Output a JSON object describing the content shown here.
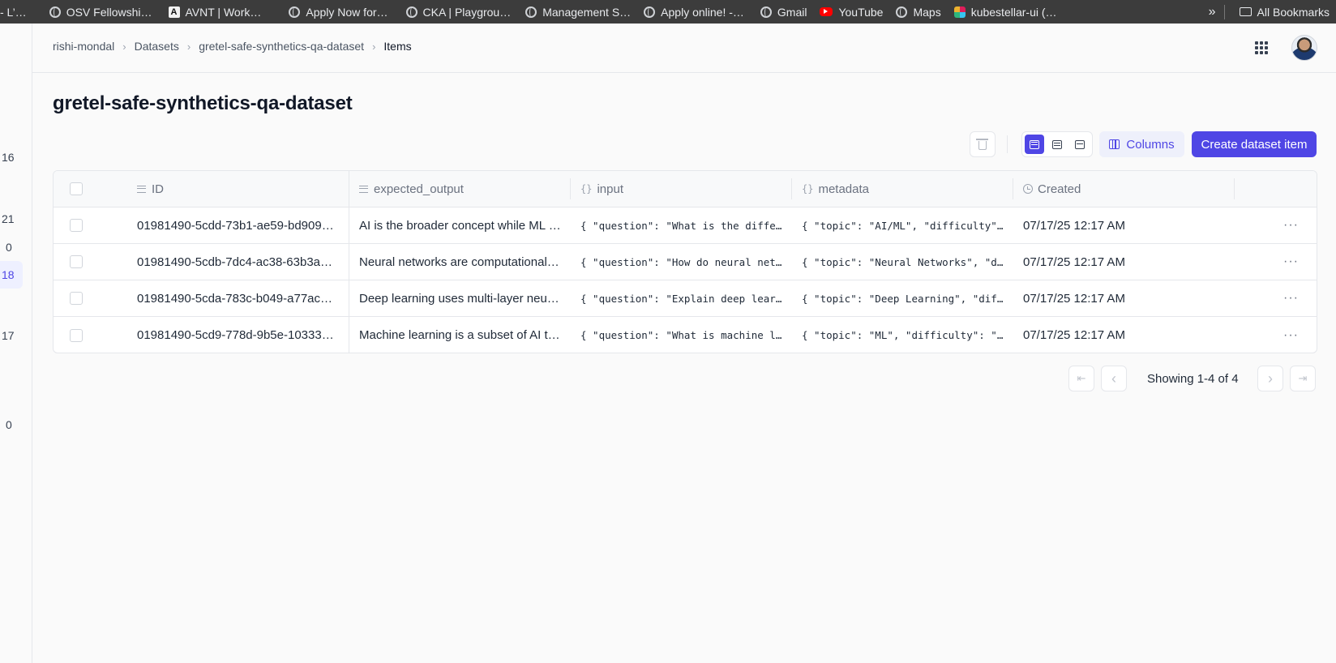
{
  "bookmarks": {
    "items": [
      {
        "label": "- L’…",
        "icon": "none"
      },
      {
        "label": "OSV Fellowshi…",
        "icon": "globe-icon"
      },
      {
        "label": "AVNT | Work…",
        "icon": "anthropic-icon"
      },
      {
        "label": "Apply Now for…",
        "icon": "globe-icon"
      },
      {
        "label": "CKA | Playgrou…",
        "icon": "globe-icon"
      },
      {
        "label": "Management S…",
        "icon": "globe-icon"
      },
      {
        "label": "Apply online! -…",
        "icon": "globe-icon"
      },
      {
        "label": "Gmail",
        "icon": "globe-icon"
      },
      {
        "label": "YouTube",
        "icon": "youtube-icon"
      },
      {
        "label": "Maps",
        "icon": "globe-icon"
      },
      {
        "label": "kubestellar-ui (…",
        "icon": "slack-icon"
      }
    ],
    "overflow": "»",
    "all_bookmarks": "All Bookmarks"
  },
  "sidebar": {
    "numbers": [
      "16",
      "21",
      "0",
      "18",
      "17",
      "0"
    ]
  },
  "breadcrumb": {
    "items": [
      "rishi-mondal",
      "Datasets",
      "gretel-safe-synthetics-qa-dataset",
      "Items"
    ]
  },
  "page": {
    "title": "gretel-safe-synthetics-qa-dataset"
  },
  "toolbar": {
    "columns_label": "Columns",
    "create_label": "Create dataset item"
  },
  "table": {
    "columns": [
      "ID",
      "expected_output",
      "input",
      "metadata",
      "Created"
    ],
    "rows": [
      {
        "id": "01981490-5cdd-73b1-ae59-bd909…",
        "expected_output": "AI is the broader concept while ML …",
        "input": "{ \"question\": \"What is the differe…",
        "metadata": "{ \"topic\": \"AI/ML\", \"difficulty\": …",
        "created": "07/17/25 12:17 AM"
      },
      {
        "id": "01981490-5cdb-7dc4-ac38-63b3a…",
        "expected_output": "Neural networks are computational …",
        "input": "{ \"question\": \"How do neural netwo…",
        "metadata": "{ \"topic\": \"Neural Networks\", \"dif…",
        "created": "07/17/25 12:17 AM"
      },
      {
        "id": "01981490-5cda-783c-b049-a77ac…",
        "expected_output": "Deep learning uses multi-layer neur…",
        "input": "{ \"question\": \"Explain deep learni…",
        "metadata": "{ \"topic\": \"Deep Learning\", \"diffi…",
        "created": "07/17/25 12:17 AM"
      },
      {
        "id": "01981490-5cd9-778d-9b5e-10333…",
        "expected_output": "Machine learning is a subset of AI t…",
        "input": "{ \"question\": \"What is machine lea…",
        "metadata": "{ \"topic\": \"ML\", \"difficulty\": \"be…",
        "created": "07/17/25 12:17 AM"
      }
    ]
  },
  "pagination": {
    "text": "Showing 1-4 of 4",
    "first": "⇤",
    "prev": "‹",
    "next": "›",
    "last": "⇥"
  },
  "colors": {
    "accent": "#4f46e5",
    "bookmark_bar": "#3c3c3c"
  }
}
